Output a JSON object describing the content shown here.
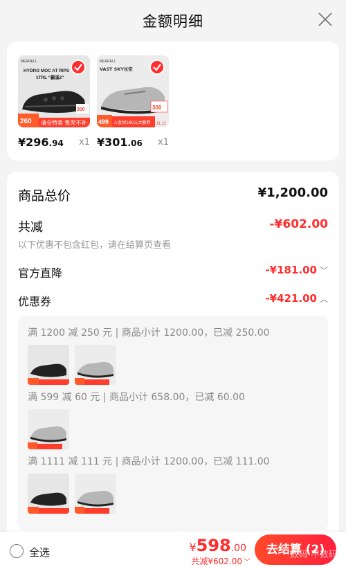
{
  "header": {
    "title": "金额明细"
  },
  "products": [
    {
      "brand": "MERRELL",
      "name_line1": "HYDRO MOC AT RIPS",
      "name_line2": "1TRL “霸溪2”",
      "badge_price": "260",
      "promo_text": "清仓特卖 售完不补",
      "side_price": "300",
      "price_main": "¥296",
      "price_dec": ".94",
      "qty": "x1"
    },
    {
      "brand": "MERRELL",
      "name_line1": "VAST SKY长空",
      "badge_price": "499",
      "promo_text": "入会领180元大额券",
      "side_price": "300",
      "side_note": "11.11",
      "price_main": "¥301",
      "price_dec": ".06",
      "qty": "x1"
    }
  ],
  "detail": {
    "total_label": "商品总价",
    "total_value": "¥1,200.00",
    "discount_label": "共减",
    "discount_value": "-¥602.00",
    "discount_note": "以下优惠不包含红包，请在结算页查看",
    "official_label": "官方直降",
    "official_value": "-¥181.00",
    "coupon_label": "优惠券",
    "coupon_value": "-¥421.00",
    "coupon_lines": [
      "满 1200 减 250 元 | 商品小计 1200.00，已减 250.00",
      "满 599 减 60 元 | 商品小计 658.00，已减 60.00",
      "满 1111 减 111 元 | 商品小计 1200.00，已减 111.00"
    ]
  },
  "footer": {
    "select_all": "全选",
    "currency": "¥",
    "total_int": "598",
    "total_dec": ".00",
    "saved": "共减¥602.00",
    "checkout": "去结算 (2)",
    "watermark": "数码 不数码"
  },
  "colors": {
    "accent": "#ff2d2d",
    "background": "#f4f4f4",
    "card": "#ffffff"
  }
}
